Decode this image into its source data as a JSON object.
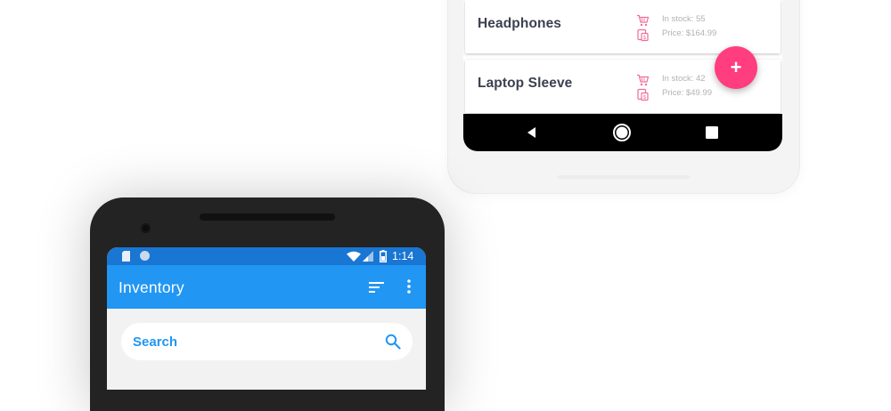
{
  "back_phone": {
    "products": [
      {
        "name": "Headphones",
        "stock": "In stock: 55",
        "price": "Price: $164.99"
      },
      {
        "name": "Laptop Sleeve",
        "stock": "In stock: 42",
        "price": "Price: $49.99"
      }
    ],
    "fab_icon": "+",
    "navbar": {
      "back_icon": "back-triangle-icon",
      "home_icon": "home-circle-icon",
      "recents_icon": "recents-square-icon"
    }
  },
  "front_phone": {
    "status_bar": {
      "time": "1:14",
      "icons": [
        "sd-card-icon",
        "sync-dot-icon",
        "wifi-icon",
        "signal-icon",
        "battery-icon"
      ]
    },
    "app_bar": {
      "title": "Inventory",
      "icons": [
        "sort-icon",
        "more-vert-icon"
      ]
    },
    "search": {
      "placeholder": "Search",
      "icon": "search-icon"
    }
  },
  "colors": {
    "primary": "#2196f3",
    "primary_dark": "#1976d2",
    "accent": "#ff3d7f",
    "card_icon": "#f06c9b",
    "card_text": "#3b4150",
    "muted_text": "#b2b2b2"
  }
}
